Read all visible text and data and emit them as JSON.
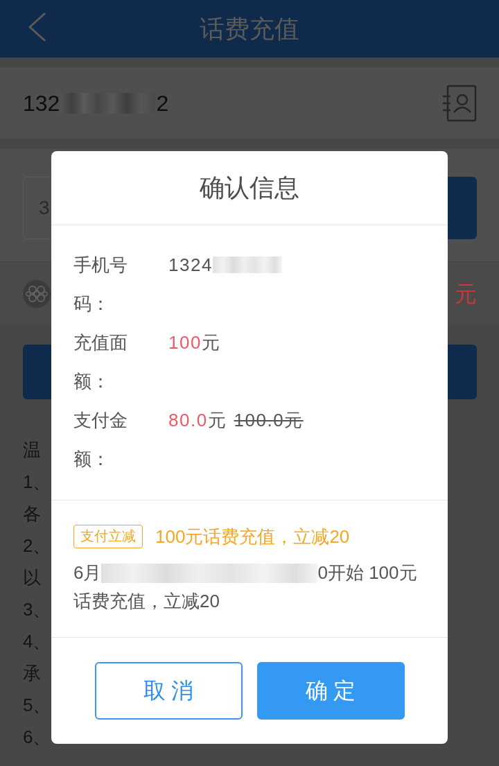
{
  "nav_bar": {
    "title": "话费充值"
  },
  "phone_row": {
    "number_start": "132",
    "number_end": "2"
  },
  "amount_options": [
    {
      "text": "3",
      "selected": false
    },
    {
      "selected": true
    }
  ],
  "operator_row": {
    "price_fragment": "元"
  },
  "notes": {
    "fragments": [
      "温",
      "1、",
      "各",
      "2、",
      "以",
      "3、",
      "4、",
      "承",
      "5、",
      "6、"
    ]
  },
  "dialog": {
    "title": "确认信息",
    "phone": {
      "label": "手机号码：",
      "value_start": "1324"
    },
    "face_value": {
      "label": "充值面额：",
      "amount": "100",
      "unit": "元"
    },
    "payment": {
      "label": "支付金额：",
      "amount": "80.0",
      "unit": "元",
      "original_price": "100.0元"
    },
    "promo": {
      "tag": "支付立减",
      "title": "100元话费充值，立减20",
      "detail_start": "6月",
      "detail_rest": "0开始 100元",
      "detail_line_2": "话费充值，立减20"
    },
    "buttons": [
      {
        "label": "取 消",
        "kind": "outline"
      },
      {
        "label": "确 定",
        "kind": "filled"
      }
    ]
  }
}
